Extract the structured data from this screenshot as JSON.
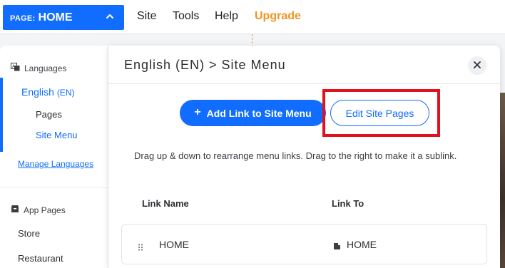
{
  "topbar": {
    "page_prefix": "PAGE:",
    "page_name": "HOME",
    "nav": {
      "site": "Site",
      "tools": "Tools",
      "help": "Help",
      "upgrade": "Upgrade"
    }
  },
  "languages_panel": {
    "heading": "Languages",
    "current_language": "English",
    "current_language_code": "(EN)",
    "subitems": {
      "pages": "Pages",
      "site_menu": "Site Menu"
    },
    "manage_link": "Manage Languages",
    "app_pages_heading": "App Pages",
    "app_pages": {
      "store": "Store",
      "restaurant": "Restaurant"
    }
  },
  "dialog": {
    "title": "English (EN) > Site Menu",
    "add_link_label": "Add Link to Site Menu",
    "edit_pages_label": "Edit Site Pages",
    "instructions": "Drag up & down to rearrange menu links. Drag to the right to make it a sublink.",
    "columns": {
      "link_name": "Link Name",
      "link_to": "Link To"
    },
    "rows": [
      {
        "name": "HOME",
        "target": "HOME"
      }
    ]
  },
  "colors": {
    "accent": "#116dff",
    "upgrade": "#f3931f",
    "highlight": "#e1111d"
  }
}
